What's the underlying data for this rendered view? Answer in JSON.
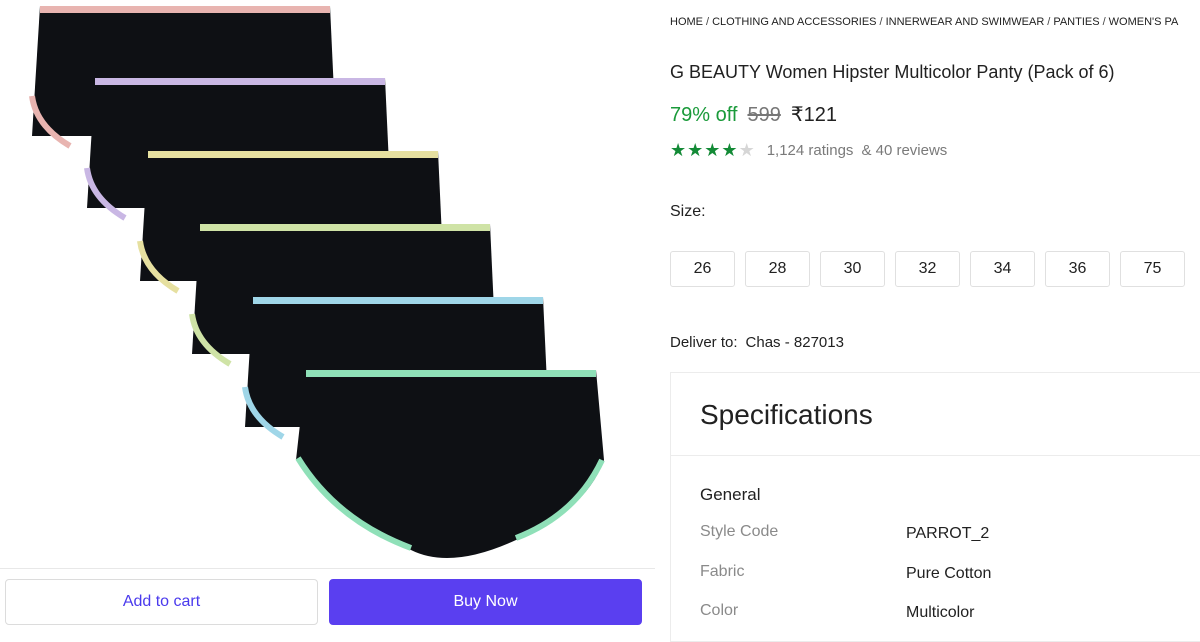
{
  "breadcrumb": [
    "HOME",
    "CLOTHING AND ACCESSORIES",
    "INNERWEAR AND SWIMWEAR",
    "PANTIES",
    "WOMEN'S PA"
  ],
  "breadcrumb_separator": "/",
  "product": {
    "title": "G BEAUTY Women Hipster Multicolor Panty (Pack of 6)",
    "discount": "79% off",
    "mrp": "599",
    "price": "₹121",
    "rating_stars": 4,
    "rating_max": 5,
    "ratings_text": "1,124 ratings",
    "reviews_text": "& 40 reviews"
  },
  "size": {
    "label": "Size:",
    "options": [
      "26",
      "28",
      "30",
      "32",
      "34",
      "36",
      "75"
    ]
  },
  "delivery": {
    "label": "Deliver to:",
    "location": "Chas - 827013"
  },
  "specifications": {
    "title": "Specifications",
    "section": "General",
    "rows": [
      {
        "key": "Style Code",
        "value": "PARROT_2"
      },
      {
        "key": "Fabric",
        "value": "Pure Cotton"
      },
      {
        "key": "Color",
        "value": "Multicolor"
      }
    ]
  },
  "actions": {
    "add_to_cart": "Add to cart",
    "buy_now": "Buy Now"
  },
  "colors": {
    "accent": "#5a3ff0",
    "discount": "#1a9a3a",
    "star": "#138a36",
    "panty_trims": [
      "#e8b4b0",
      "#c9b7e4",
      "#e6e0a0",
      "#cfe3a6",
      "#9fd6e8",
      "#8fe0b8"
    ]
  }
}
